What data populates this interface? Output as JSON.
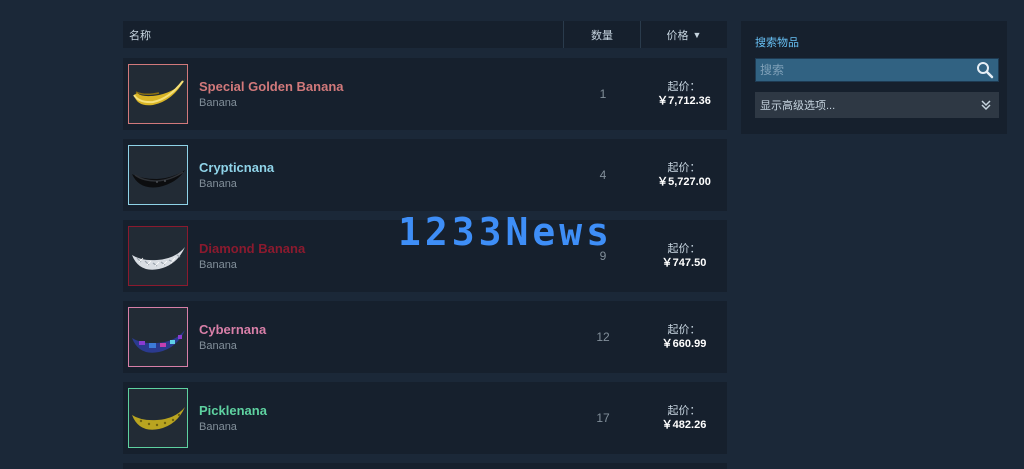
{
  "table": {
    "header_name": "名称",
    "header_qty": "数量",
    "header_price": "价格",
    "sort_icon": "sort-down-icon"
  },
  "items": [
    {
      "name": "Special Golden Banana",
      "game": "Banana",
      "qty": "1",
      "price_label": "起价：",
      "price": "￥7,712.36",
      "name_color": "#d2797b",
      "border_color": "#d2797b"
    },
    {
      "name": "Crypticnana",
      "game": "Banana",
      "qty": "4",
      "price_label": "起价：",
      "price": "￥5,727.00",
      "name_color": "#8fd3e8",
      "border_color": "#8fd3e8"
    },
    {
      "name": "Diamond Banana",
      "game": "Banana",
      "qty": "9",
      "price_label": "起价：",
      "price": "￥747.50",
      "name_color": "#8b1a2e",
      "border_color": "#8b1a2e"
    },
    {
      "name": "Cybernana",
      "game": "Banana",
      "qty": "12",
      "price_label": "起价：",
      "price": "￥660.99",
      "name_color": "#d87fa8",
      "border_color": "#d87fa8"
    },
    {
      "name": "Picklenana",
      "game": "Banana",
      "qty": "17",
      "price_label": "起价：",
      "price": "￥482.26",
      "name_color": "#5ed1a0",
      "border_color": "#5ed1a0"
    }
  ],
  "search": {
    "title": "搜索物品",
    "placeholder": "搜索",
    "advanced_label": "显示高级选项..."
  },
  "watermark": "1233News",
  "colors": {
    "background": "#1b2838",
    "row": "#16202d",
    "accent": "#67c1f5"
  }
}
